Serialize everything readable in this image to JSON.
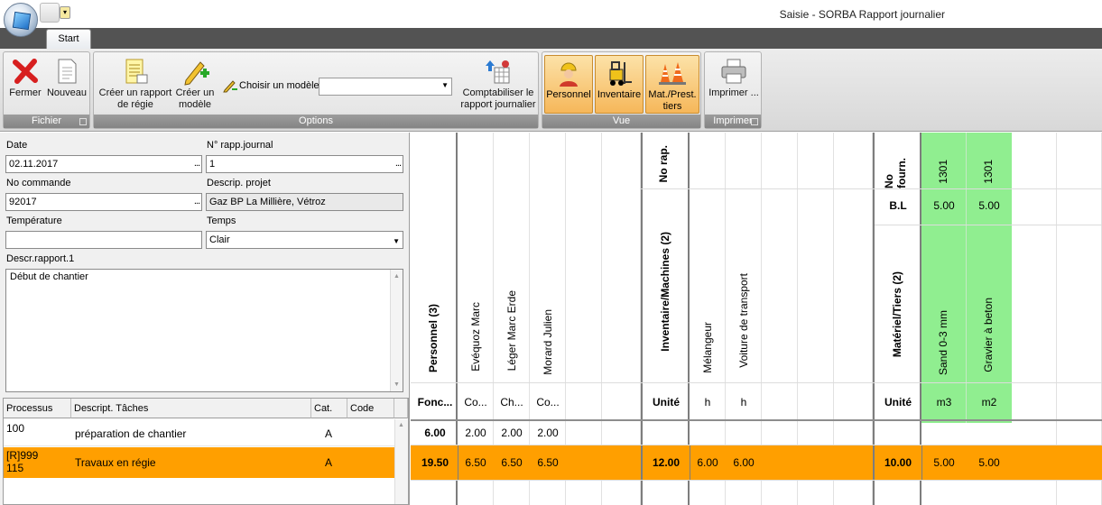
{
  "window": {
    "title": "Saisie - SORBA Rapport journalier"
  },
  "qat": {
    "dropdown_glyph": "▾"
  },
  "tabs": [
    {
      "label": "Start"
    }
  ],
  "ribbon": {
    "groups": {
      "fichier": "Fichier",
      "options": "Options",
      "vue": "Vue",
      "imprimer": "Imprimer"
    },
    "fermer": "Fermer",
    "nouveau": "Nouveau",
    "creer_rapport": "Créer un rapport de régie",
    "creer_modele": "Créer un modèle",
    "choisir_modele": "Choisir un modèle",
    "modele_value": "",
    "comptabiliser": "Comptabiliser le rapport journalier",
    "personnel": "Personnel",
    "inventaire": "Inventaire",
    "mat_prest": "Mat./Prest. tiers",
    "imprimer_btn": "Imprimer ..."
  },
  "form": {
    "date_label": "Date",
    "date_value": "02.11.2017",
    "rapp_label": "N° rapp.journal",
    "rapp_value": "1",
    "commande_label": "No commande",
    "commande_value": "92017",
    "projet_label": "Descrip. projet",
    "projet_value": "Gaz BP La Millière, Vétroz",
    "temperature_label": "Température",
    "temperature_value": "",
    "temps_label": "Temps",
    "temps_value": "Clair",
    "descr_label": "Descr.rapport.1",
    "descr_value": "Début de chantier",
    "ellipsis": "..."
  },
  "grid": {
    "headers": [
      "Processus",
      "Descript. Tâches",
      "Cat.",
      "Code"
    ],
    "rows": [
      {
        "processus": "100",
        "tache": "préparation de chantier",
        "cat": "A",
        "code": ""
      },
      {
        "processus": "[R]999\n115",
        "tache": "Travaux en régie",
        "cat": "A",
        "code": ""
      }
    ]
  },
  "matrix": {
    "personnel": {
      "title": "Personnel (3)",
      "unit_label": "Fonc...",
      "names": [
        "Evéquoz Marc",
        "Léger Marc Erde",
        "Morard Julien"
      ],
      "units": [
        "Co...",
        "Ch...",
        "Co..."
      ],
      "row1_total": "6.00",
      "row1": [
        "2.00",
        "2.00",
        "2.00"
      ],
      "row2_total": "19.50",
      "row2": [
        "6.50",
        "6.50",
        "6.50"
      ]
    },
    "inventaire": {
      "norap_label": "No rap.",
      "title": "Inventaire/Machines (2)",
      "unit_label": "Unité",
      "names": [
        "Mélangeur",
        "Voiture de transport"
      ],
      "units": [
        "h",
        "h"
      ],
      "row2_total": "12.00",
      "row2": [
        "6.00",
        "6.00"
      ]
    },
    "materiel": {
      "nofourn_label": "No fourn.",
      "bl_label": "B.L",
      "title": "Matériel/Tiers (2)",
      "unit_label": "Unité",
      "fourn": [
        "1301",
        "1301"
      ],
      "bl": [
        "5.00",
        "5.00"
      ],
      "names": [
        "Sand 0-3 mm",
        "Gravier à beton"
      ],
      "units": [
        "m3",
        "m2"
      ],
      "row2_total": "10.00",
      "row2": [
        "5.00",
        "5.00"
      ]
    }
  },
  "colors": {
    "accent_orange": "#ff9f00",
    "green": "#90ee90",
    "view_selected": "#f8c068"
  }
}
